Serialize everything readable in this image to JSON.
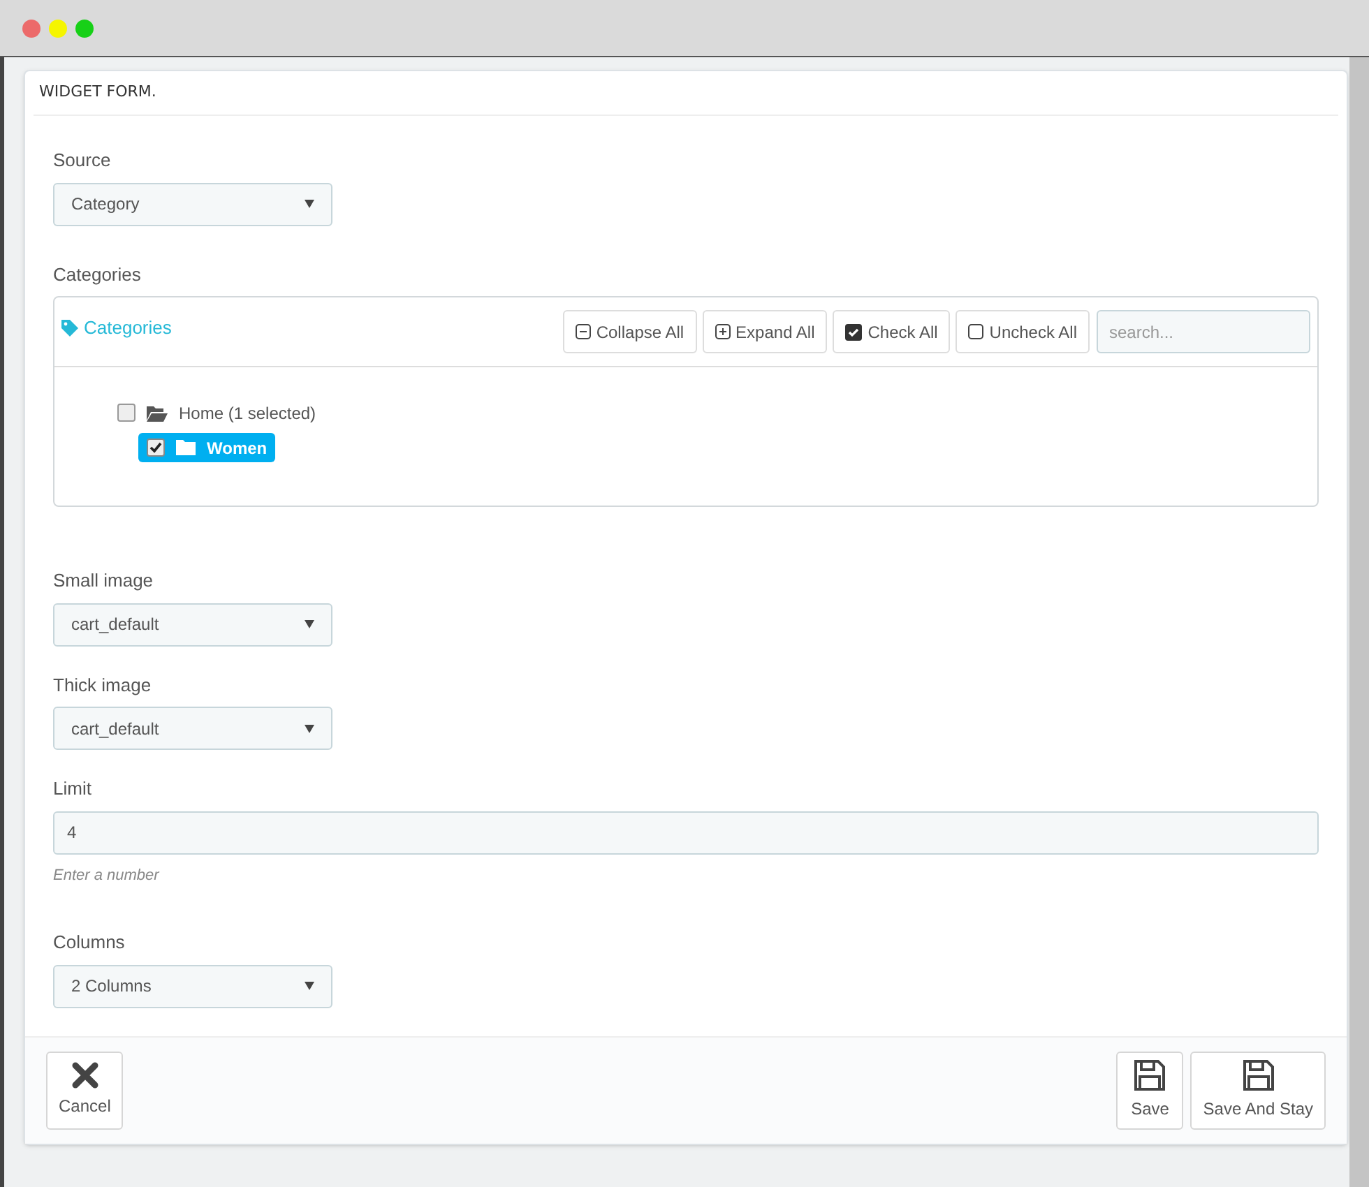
{
  "panel": {
    "title": "WIDGET FORM."
  },
  "source": {
    "label": "Source",
    "value": "Category"
  },
  "categories": {
    "label": "Categories",
    "tree_title": "Categories",
    "toolbar": [
      {
        "kind": "collapse",
        "label": "Collapse All"
      },
      {
        "kind": "expand",
        "label": "Expand All"
      },
      {
        "kind": "check",
        "label": "Check All"
      },
      {
        "kind": "uncheck",
        "label": "Uncheck All"
      }
    ],
    "search": {
      "placeholder": "search..."
    },
    "tree": [
      {
        "label": "Home (1 selected)",
        "checked": false,
        "selected": false,
        "expanded": true,
        "children": [
          {
            "label": "Women",
            "checked": true,
            "selected": true,
            "expanded": false
          }
        ]
      }
    ]
  },
  "small_image": {
    "label": "Small image",
    "value": "cart_default"
  },
  "thick_image": {
    "label": "Thick image",
    "value": "cart_default"
  },
  "limit": {
    "label": "Limit",
    "value": "4",
    "help": "Enter a number"
  },
  "columns": {
    "label": "Columns",
    "value": "2 Columns"
  },
  "footer": {
    "left": [
      {
        "kind": "cancel",
        "label": "Cancel"
      }
    ],
    "right": [
      {
        "kind": "save",
        "label": "Save"
      },
      {
        "kind": "save",
        "label": "Save And Stay"
      }
    ]
  }
}
